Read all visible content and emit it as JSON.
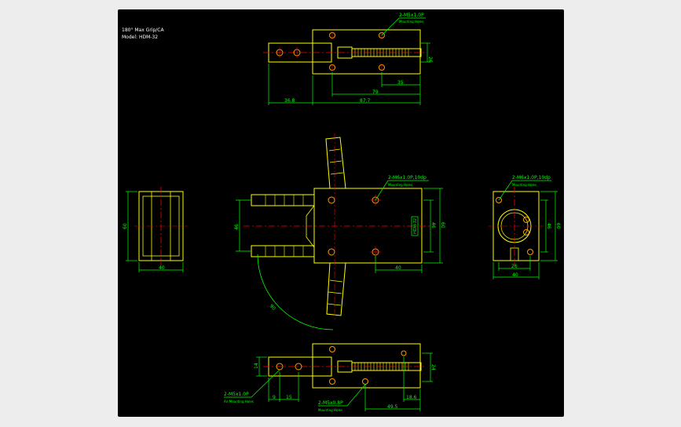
{
  "colors": {
    "background": "#000000",
    "outline": "#ffff00",
    "dimension": "#00ff00",
    "centerline": "#ff0000",
    "hole": "#ff9900",
    "text": "#ffffff"
  },
  "title_block": {
    "line1": "180° Max Grip/CA",
    "line2": "Model: HDM-32"
  },
  "top_view": {
    "callout": "2-M5x1.0P",
    "callout_sub": "Mounting Holes",
    "dims": {
      "height": "26",
      "d1": "35",
      "d2": "79",
      "left": "36.8",
      "total": "87.7"
    }
  },
  "side_left": {
    "dims": {
      "height": "60",
      "width": "40"
    }
  },
  "front_view": {
    "callout": "2-M6x1.0P,10dp",
    "callout_sub": "Mounting Holes",
    "dims": {
      "grip": "46",
      "h_inner": "46",
      "h_outer": "60",
      "width": "40",
      "angle": "90"
    },
    "label": "HDM-32"
  },
  "side_right": {
    "callout": "2-M6x1.0P,10dp",
    "callout_sub": "Mounting Holes",
    "dims": {
      "height": "60",
      "h_inner": "46",
      "width_inner": "26",
      "width": "40"
    }
  },
  "bottom_view": {
    "callout_left": "2-M5x1.0P",
    "callout_left_sub": "Air Mounting Holes",
    "callout_mid": "2-M5x0.8P",
    "callout_mid_sub": "Mounting Holes",
    "dims": {
      "left_h": "14",
      "d9": "9",
      "d15": "15",
      "right_h": "24",
      "d186": "18.6",
      "d495": "49.5"
    }
  }
}
